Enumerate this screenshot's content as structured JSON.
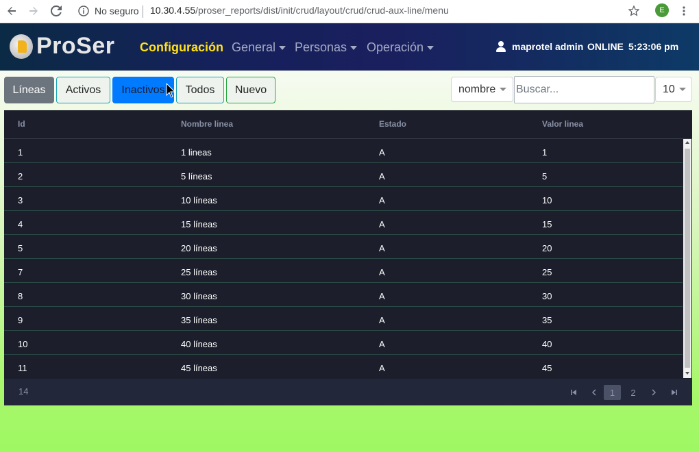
{
  "browser": {
    "security_label": "No seguro",
    "url_host": "10.30.4.55",
    "url_path": "/proser_reports/dist/init/crud/layout/crud/crud-aux-line/menu",
    "profile_initial": "E"
  },
  "navbar": {
    "logo_text": "ProSer",
    "items": [
      {
        "label": "Configuración",
        "active": true,
        "dropdown": false
      },
      {
        "label": "General",
        "active": false,
        "dropdown": true
      },
      {
        "label": "Personas",
        "active": false,
        "dropdown": true
      },
      {
        "label": "Operación",
        "active": false,
        "dropdown": true
      }
    ],
    "user": "maprotel admin",
    "status": "ONLINE",
    "time": "5:23:06 pm"
  },
  "toolbar": {
    "buttons": [
      "Líneas",
      "Activos",
      "Inactivos",
      "Todos",
      "Nuevo"
    ],
    "field_select": "nombre",
    "search_placeholder": "Buscar...",
    "page_size": "10"
  },
  "table": {
    "columns": [
      "Id",
      "Nombre linea",
      "Estado",
      "Valor linea"
    ],
    "rows": [
      [
        "1",
        "1 lineas",
        "A",
        "1"
      ],
      [
        "2",
        "5 líneas",
        "A",
        "5"
      ],
      [
        "3",
        "10 líneas",
        "A",
        "10"
      ],
      [
        "4",
        "15 líneas",
        "A",
        "15"
      ],
      [
        "5",
        "20 líneas",
        "A",
        "20"
      ],
      [
        "7",
        "25 líneas",
        "A",
        "25"
      ],
      [
        "8",
        "30 líneas",
        "A",
        "30"
      ],
      [
        "9",
        "35 líneas",
        "A",
        "35"
      ],
      [
        "10",
        "40 líneas",
        "A",
        "40"
      ],
      [
        "11",
        "45 líneas",
        "A",
        "45"
      ]
    ],
    "total": "14",
    "pages": [
      "1",
      "2"
    ],
    "current_page": "1"
  },
  "colors": {
    "accent_active_nav": "#ffe21b",
    "primary_button": "#007bff",
    "table_bg": "#1c1f2b"
  }
}
